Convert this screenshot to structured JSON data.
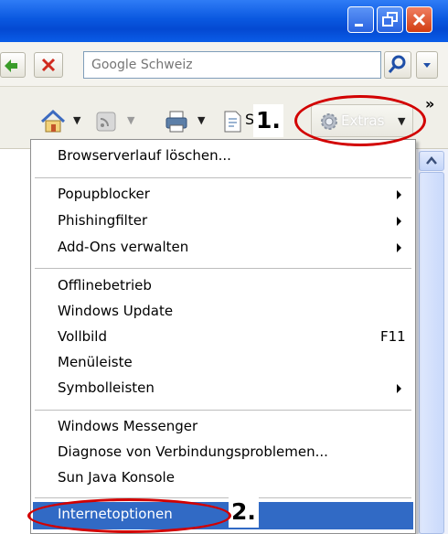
{
  "titlebar": {
    "buttons": [
      "minimize",
      "restore",
      "close"
    ]
  },
  "search": {
    "placeholder": "Google Schweiz"
  },
  "commandbar": {
    "truncated_label": "S",
    "overflow": "»",
    "extras_label": "Extras"
  },
  "annotations": {
    "step1": "1.",
    "step2": "2."
  },
  "menu": {
    "items": [
      {
        "label": "Browserverlauf löschen..."
      },
      {
        "label": "Popupblocker"
      },
      {
        "label": "Phishingfilter"
      },
      {
        "label": "Add-Ons verwalten"
      },
      {
        "label": "Offlinebetrieb"
      },
      {
        "label": "Windows Update"
      },
      {
        "label": "Vollbild",
        "shortcut": "F11"
      },
      {
        "label": "Menüleiste"
      },
      {
        "label": "Symbolleisten"
      },
      {
        "label": "Windows Messenger"
      },
      {
        "label": "Diagnose von Verbindungsproblemen..."
      },
      {
        "label": "Sun Java Konsole"
      },
      {
        "label": "Internetoptionen",
        "selected": true
      }
    ]
  },
  "colors": {
    "titlebar": "#0a58e0",
    "highlight": "#316ac5",
    "annotation": "#d20000"
  }
}
